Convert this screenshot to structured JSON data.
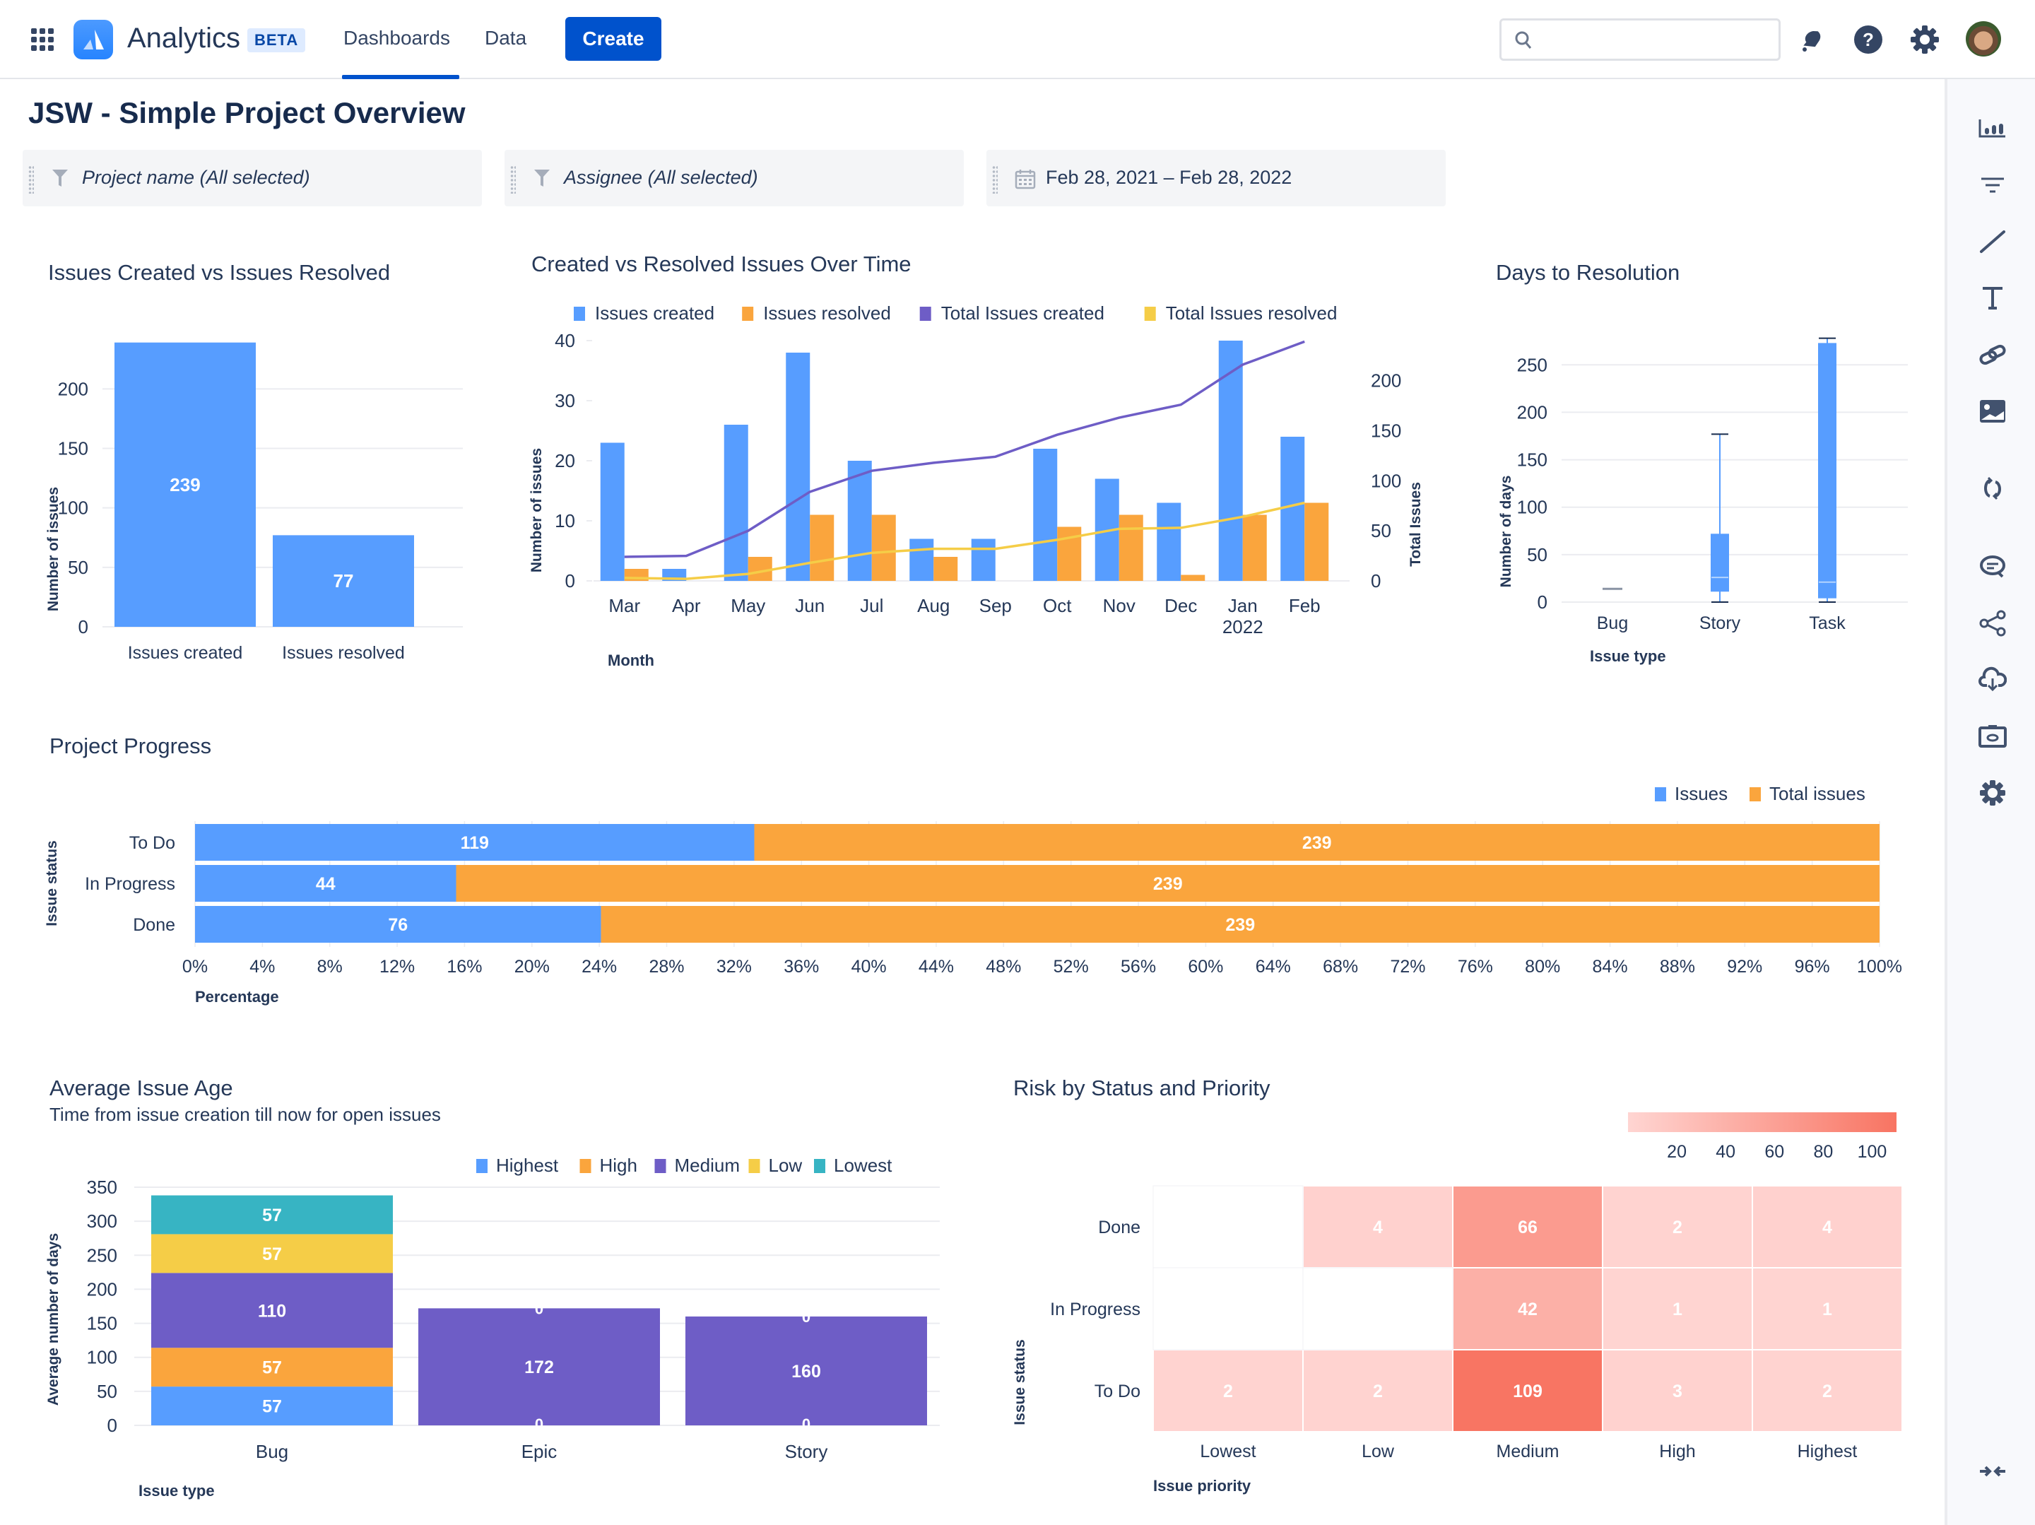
{
  "topbar": {
    "app_name": "Analytics",
    "badge": "BETA",
    "nav": [
      {
        "label": "Dashboards",
        "active": true
      },
      {
        "label": "Data",
        "active": false
      }
    ],
    "create_label": "Create",
    "search_placeholder": "",
    "icons": [
      "app-switcher-icon",
      "notifications-icon",
      "help-icon",
      "settings-icon",
      "avatar"
    ]
  },
  "page": {
    "title": "JSW - Simple Project Overview",
    "filters": [
      {
        "icon": "filter-icon",
        "label": "Project name (All selected)"
      },
      {
        "icon": "filter-icon",
        "label": "Assignee (All selected)"
      },
      {
        "icon": "calendar-icon",
        "label": "Feb 28, 2021  –  Feb 28, 2022"
      }
    ]
  },
  "right_toolbar": [
    "chart-icon",
    "filter-icon",
    "line-icon",
    "text-icon",
    "link-icon",
    "image-icon",
    "refresh-icon",
    "comment-icon",
    "share-icon",
    "cloud-download-icon",
    "camera-icon",
    "settings-icon",
    "collapse-icon"
  ],
  "colors": {
    "blue": "#579dff",
    "orange": "#faa53d",
    "purple": "#6e5dc6",
    "yellow": "#f5cd47",
    "teal": "#37b4c3",
    "primary": "#0052cc",
    "heat_low": "#ffd5d2",
    "heat_high": "#f87462"
  },
  "chart_data": [
    {
      "id": "issues-created-vs-resolved",
      "type": "bar",
      "title": "Issues Created vs Issues Resolved",
      "categories": [
        "Issues created",
        "Issues resolved"
      ],
      "values": [
        239,
        77
      ],
      "xlabel": "",
      "ylabel": "Number of issues",
      "ylim": [
        0,
        240
      ],
      "yticks": [
        0,
        50,
        100,
        150,
        200
      ],
      "grid": true
    },
    {
      "id": "created-vs-resolved-over-time",
      "type": "bar",
      "title": "Created vs Resolved Issues Over Time",
      "categories": [
        "Mar",
        "Apr",
        "May",
        "Jun",
        "Jul",
        "Aug",
        "Sep",
        "Oct",
        "Nov",
        "Dec",
        "Jan",
        "Feb"
      ],
      "category_sublabels": {
        "Jan": "2022"
      },
      "series": [
        {
          "name": "Issues created",
          "kind": "bar",
          "axis": "left",
          "values": [
            23,
            2,
            26,
            38,
            20,
            7,
            7,
            22,
            17,
            13,
            40,
            24
          ]
        },
        {
          "name": "Issues resolved",
          "kind": "bar",
          "axis": "left",
          "values": [
            2,
            0,
            4,
            11,
            11,
            4,
            0,
            9,
            11,
            1,
            11,
            13
          ]
        },
        {
          "name": "Total Issues created",
          "kind": "line",
          "axis": "right",
          "values": [
            24,
            25,
            50,
            89,
            110,
            118,
            124,
            146,
            163,
            176,
            216,
            239
          ]
        },
        {
          "name": "Total Issues resolved",
          "kind": "line",
          "axis": "right",
          "values": [
            3,
            2,
            7,
            18,
            28,
            32,
            32,
            41,
            52,
            53,
            64,
            78
          ]
        }
      ],
      "xlabel": "Month",
      "ylabel": "Number of issues",
      "y2label": "Total Issues",
      "ylim": [
        0,
        40
      ],
      "y2lim": [
        0,
        240
      ],
      "yticks": [
        0,
        10,
        20,
        30,
        40
      ],
      "y2ticks": [
        0,
        50,
        100,
        150,
        200
      ],
      "legend": "top"
    },
    {
      "id": "days-to-resolution",
      "type": "box",
      "title": "Days to Resolution",
      "categories": [
        "Bug",
        "Story",
        "Task"
      ],
      "boxes": [
        {
          "min": 14,
          "q1": 14,
          "median": 14,
          "q3": 14,
          "max": 14
        },
        {
          "min": 0,
          "q1": 11,
          "median": 26,
          "q3": 72,
          "max": 177
        },
        {
          "min": 0,
          "q1": 4,
          "median": 21,
          "q3": 273,
          "max": 278
        }
      ],
      "xlabel": "Issue type",
      "ylabel": "Number of days",
      "ylim": [
        0,
        280
      ],
      "yticks": [
        0,
        50,
        100,
        150,
        200,
        250
      ]
    },
    {
      "id": "project-progress",
      "type": "bar",
      "orientation": "horizontal",
      "title": "Project Progress",
      "categories": [
        "To Do",
        "In Progress",
        "Done"
      ],
      "series": [
        {
          "name": "Issues",
          "values": [
            119,
            44,
            76
          ]
        },
        {
          "name": "Total issues",
          "values": [
            239,
            239,
            239
          ]
        }
      ],
      "percent_of_total": [
        33.2,
        15.5,
        24.1
      ],
      "xlabel": "Percentage",
      "ylabel": "Issue status",
      "xlim": [
        0,
        100
      ],
      "xticks": [
        "0%",
        "4%",
        "8%",
        "12%",
        "16%",
        "20%",
        "24%",
        "28%",
        "32%",
        "36%",
        "40%",
        "44%",
        "48%",
        "52%",
        "56%",
        "60%",
        "64%",
        "68%",
        "72%",
        "76%",
        "80%",
        "84%",
        "88%",
        "92%",
        "96%",
        "100%"
      ],
      "legend": "top-right"
    },
    {
      "id": "average-issue-age",
      "type": "bar",
      "stacked": true,
      "title": "Average Issue Age",
      "subtitle": "Time from issue creation till now for open issues",
      "categories": [
        "Bug",
        "Epic",
        "Story"
      ],
      "series": [
        {
          "name": "Highest",
          "values": [
            57,
            0,
            0
          ]
        },
        {
          "name": "High",
          "values": [
            57,
            0,
            0
          ]
        },
        {
          "name": "Medium",
          "values": [
            110,
            172,
            160
          ]
        },
        {
          "name": "Low",
          "values": [
            57,
            0,
            0
          ]
        },
        {
          "name": "Lowest",
          "values": [
            57,
            0,
            0
          ]
        }
      ],
      "xlabel": "Issue type",
      "ylabel": "Average number of days",
      "ylim": [
        0,
        350
      ],
      "yticks": [
        0,
        50,
        100,
        150,
        200,
        250,
        300,
        350
      ],
      "legend": "top-right"
    },
    {
      "id": "risk-by-status-priority",
      "type": "heatmap",
      "title": "Risk by Status and Priority",
      "x_categories": [
        "Lowest",
        "Low",
        "Medium",
        "High",
        "Highest"
      ],
      "y_categories": [
        "Done",
        "In Progress",
        "To Do"
      ],
      "values": [
        [
          null,
          4,
          66,
          2,
          4
        ],
        [
          null,
          null,
          42,
          1,
          1
        ],
        [
          2,
          2,
          109,
          3,
          2
        ]
      ],
      "xlabel": "Issue priority",
      "ylabel": "Issue status",
      "colorbar_ticks": [
        20,
        40,
        60,
        80,
        100
      ],
      "colorbar_range": [
        0,
        110
      ],
      "legend": "top-right"
    }
  ]
}
